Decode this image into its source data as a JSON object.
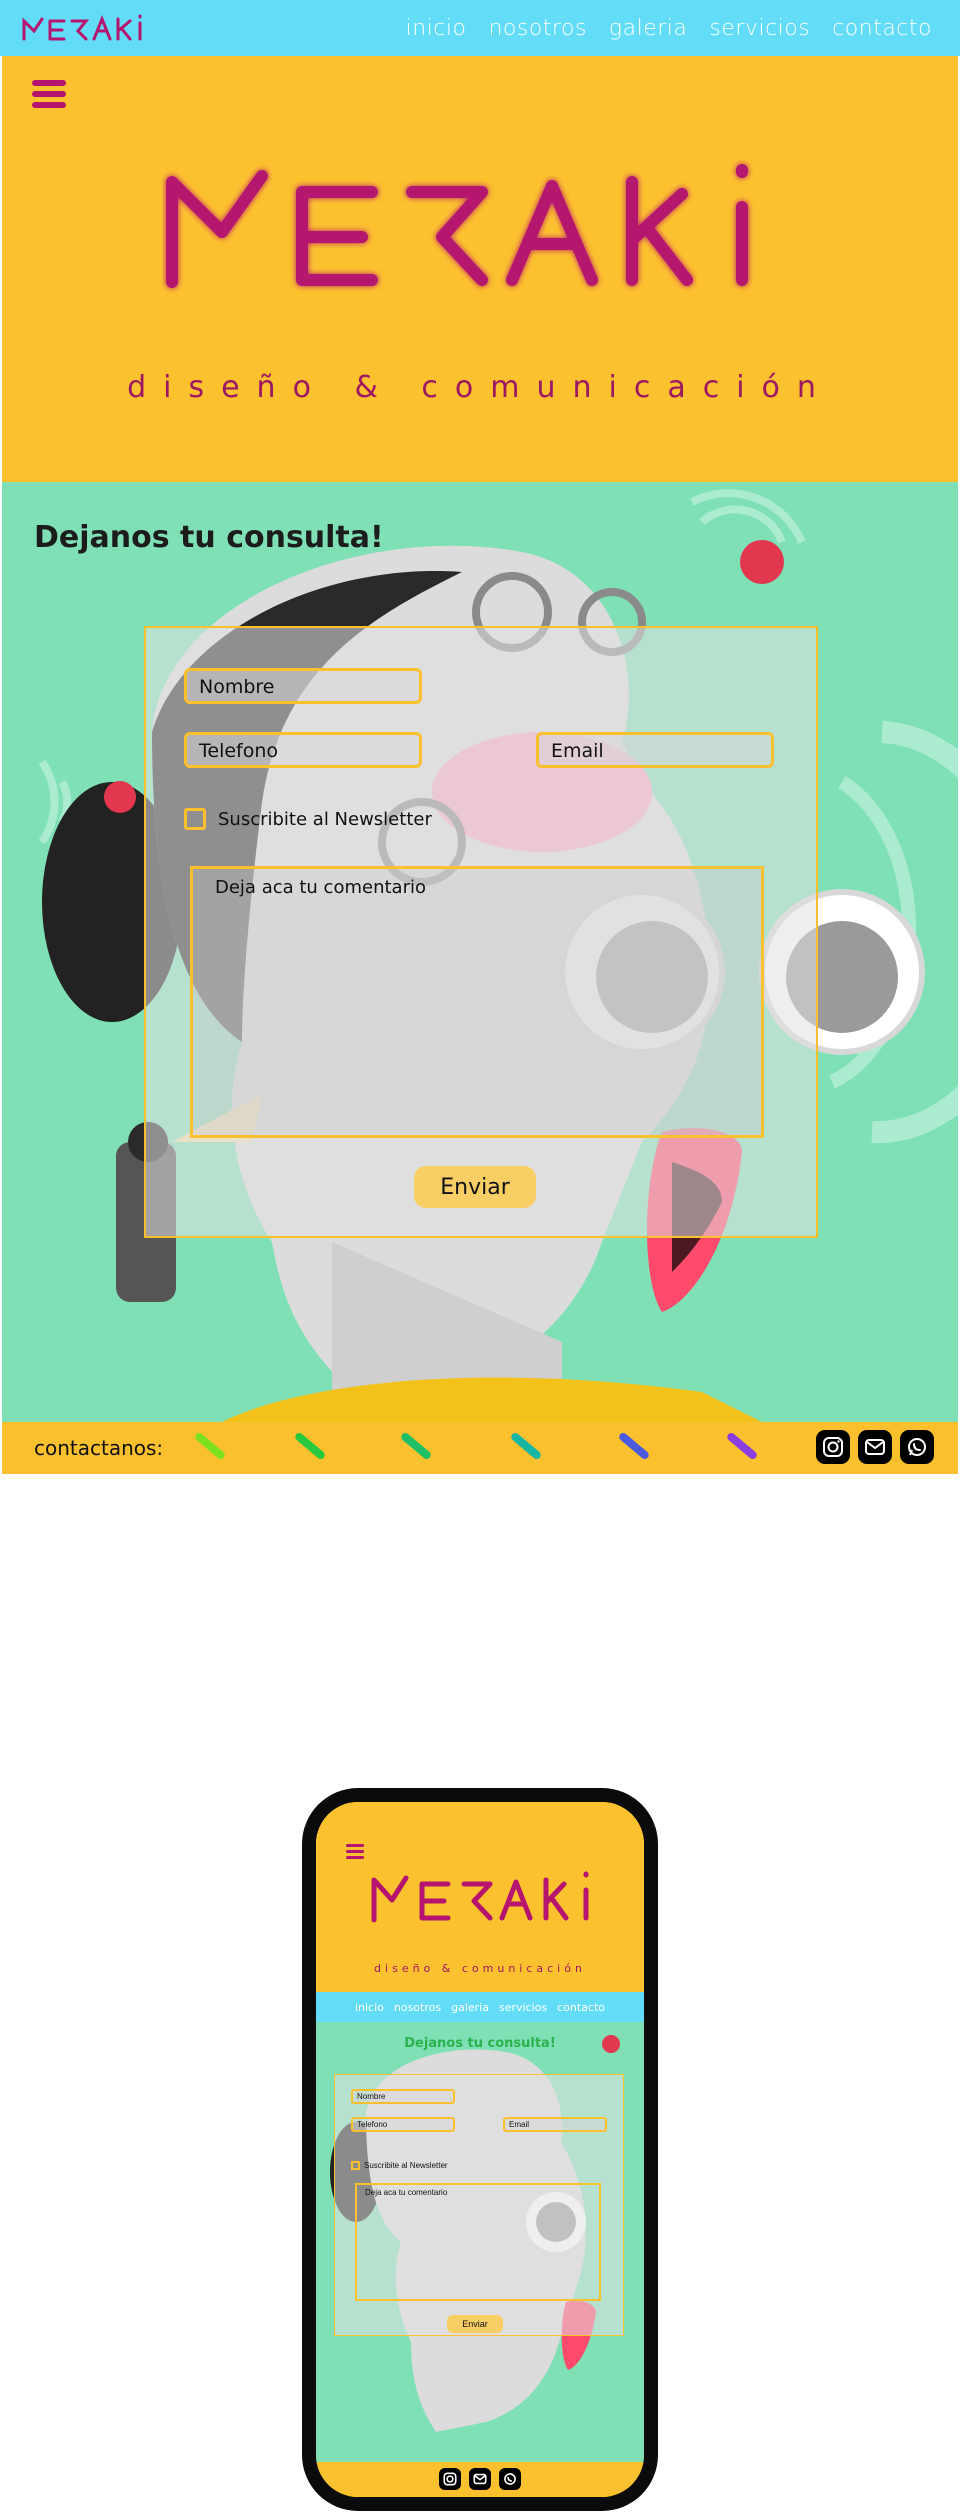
{
  "brand": {
    "name": "MERAKI",
    "tagline": "diseño & comunicación"
  },
  "nav": {
    "items": [
      {
        "label": "inicio"
      },
      {
        "label": "nosotros"
      },
      {
        "label": "galeria"
      },
      {
        "label": "servicios"
      },
      {
        "label": "contacto"
      }
    ]
  },
  "contact": {
    "title": "Dejanos tu consulta!",
    "form": {
      "name_placeholder": "Nombre",
      "phone_placeholder": "Telefono",
      "email_placeholder": "Email",
      "newsletter_label": "Suscribite al Newsletter",
      "comment_placeholder": "Deja aca tu comentario",
      "submit_label": "Enviar"
    }
  },
  "footer": {
    "label": "contactanos:",
    "social": [
      "instagram-icon",
      "mail-icon",
      "whatsapp-icon"
    ],
    "slash_colors": [
      "#7be01f",
      "#27c93f",
      "#1fbf66",
      "#16b5a4",
      "#4b5be0",
      "#8b3fe0"
    ]
  },
  "colors": {
    "nav_bg": "#63dcf8",
    "hero_bg": "#fcc12f",
    "brand": "#b5156e",
    "accent": "#fbc02d",
    "section_bg": "#7fe0b6",
    "mobile_title": "#2bb24c"
  },
  "mobile": {
    "brand": "MERAKI",
    "tagline": "diseño & comunicación",
    "nav": [
      "inicio",
      "nosotros",
      "galeria",
      "servicios",
      "contacto"
    ],
    "title": "Dejanos tu consulta!",
    "name_placeholder": "Nombre",
    "phone_placeholder": "Telefono",
    "email_placeholder": "Email",
    "newsletter_label": "Suscribite al Newsletter",
    "comment_placeholder": "Deja aca tu comentario",
    "submit_label": "Enviar"
  }
}
